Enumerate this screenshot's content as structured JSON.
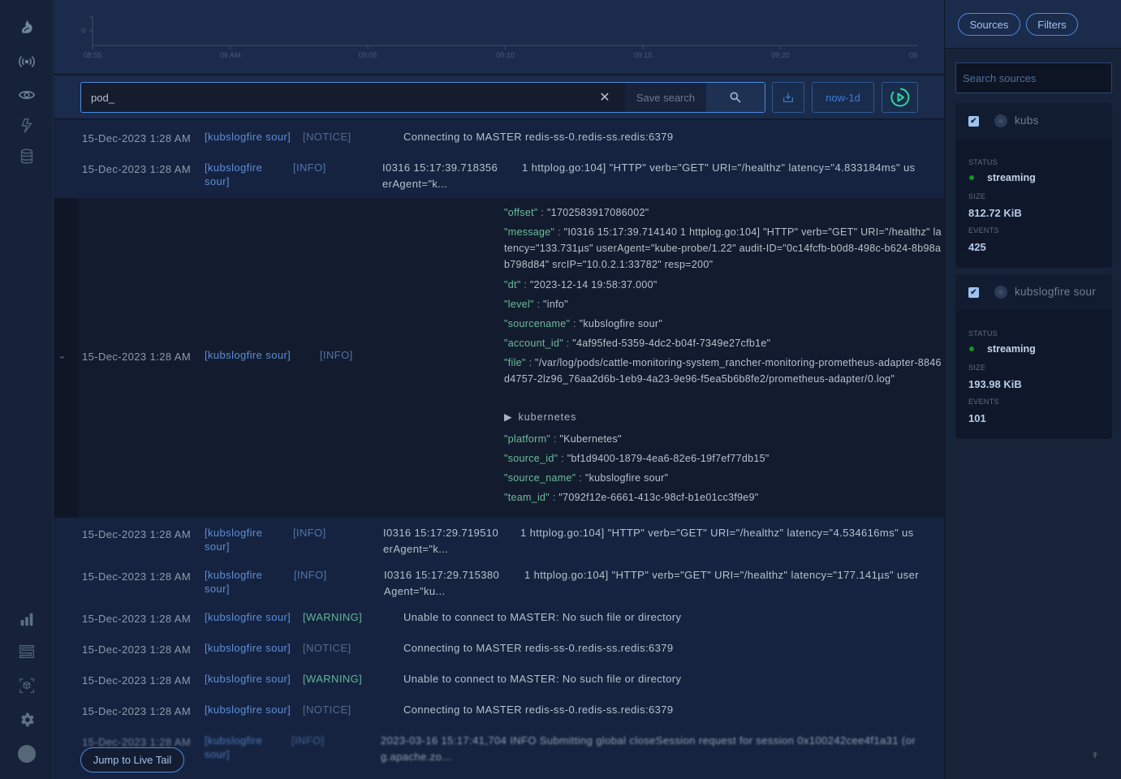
{
  "nav": {
    "icons": [
      "logo-icon",
      "live-broadcast-icon",
      "eye-icon",
      "lightning-icon",
      "database-icon",
      "bar-chart-icon",
      "logo-s-icon",
      "cube-scan-icon",
      "gear-icon",
      "avatar"
    ]
  },
  "chart": {
    "y_tick": "0",
    "x_ticks": [
      "08:55",
      "09 AM",
      "09:05",
      "09:10",
      "09:15",
      "09:20",
      "09"
    ]
  },
  "search": {
    "value": "pod_",
    "clear_label": "✕",
    "save_label": "Save search",
    "time_range": "now-1d"
  },
  "logs": {
    "rows": [
      {
        "ts": "15-Dec-2023 1:28 AM",
        "src": "[kubslogfire sour]",
        "level": "[NOTICE]",
        "msg": "Connecting to MASTER redis-ss-0.redis-ss.redis:6379"
      },
      {
        "ts": "15-Dec-2023 1:28 AM",
        "src_l1": "[kubslogfire",
        "src_l2": "sour]",
        "level": "[INFO]",
        "msg_head": "I0316 15:17:39.718356",
        "msg_tail": "1 httplog.go:104] \"HTTP\" verb=\"GET\" URI=\"/healthz\" latency=\"4.833184ms\" us",
        "msg_l2": "erAgent=\"k..."
      },
      {
        "ts": "15-Dec-2023 1:28 AM",
        "src": "[kubslogfire sour]",
        "level": "[INFO]"
      },
      {
        "ts": "15-Dec-2023 1:28 AM",
        "src_l1": "[kubslogfire",
        "src_l2": "sour]",
        "level": "[INFO]",
        "msg_head": "I0316 15:17:29.719510",
        "msg_tail": "1 httplog.go:104] \"HTTP\" verb=\"GET\" URI=\"/healthz\" latency=\"4.534616ms\" us",
        "msg_l2": "erAgent=\"k..."
      },
      {
        "ts": "15-Dec-2023 1:28 AM",
        "src_l1": "[kubslogfire",
        "src_l2": "sour]",
        "level": "[INFO]",
        "msg_head": "I0316 15:17:29.715380",
        "msg_tail": "1 httplog.go:104] \"HTTP\" verb=\"GET\" URI=\"/healthz\" latency=\"177.141µs\" user",
        "msg_l2": "Agent=\"ku..."
      },
      {
        "ts": "15-Dec-2023 1:28 AM",
        "src": "[kubslogfire sour]",
        "level": "[WARNING]",
        "msg": "Unable to connect to MASTER: No such file or directory"
      },
      {
        "ts": "15-Dec-2023 1:28 AM",
        "src": "[kubslogfire sour]",
        "level": "[NOTICE]",
        "msg": "Connecting to MASTER redis-ss-0.redis-ss.redis:6379"
      },
      {
        "ts": "15-Dec-2023 1:28 AM",
        "src": "[kubslogfire sour]",
        "level": "[WARNING]",
        "msg": "Unable to connect to MASTER: No such file or directory"
      },
      {
        "ts": "15-Dec-2023 1:28 AM",
        "src": "[kubslogfire sour]",
        "level": "[NOTICE]",
        "msg": "Connecting to MASTER redis-ss-0.redis-ss.redis:6379"
      },
      {
        "ts": "15-Dec-2023 1:28 AM",
        "src_l1": "[kubslogfire",
        "src_l2": "sour]",
        "level": "[INFO]",
        "msg_l1": "2023-03-16 15:17:41,704 INFO Submitting global closeSession request for session 0x100242cee4f1a31 (or",
        "msg_l2": "g.apache.zo..."
      }
    ],
    "expanded": {
      "fields": [
        {
          "key": "\"offset\"",
          "value": "\"1702583917086002\""
        },
        {
          "key": "\"message\"",
          "value": "\"I0316 15:17:39.714140 1 httplog.go:104] \"HTTP\" verb=\"GET\" URI=\"/healthz\" latency=\"133.731µs\" userAgent=\"kube-probe/1.22\" audit-ID=\"0c14fcfb-b0d8-498c-b624-8b98ab798d84\" srcIP=\"10.0.2.1:33782\" resp=200\""
        },
        {
          "key": "\"dt\"",
          "value": "\"2023-12-14 19:58:37.000\""
        },
        {
          "key": "\"level\"",
          "value": "\"info\""
        },
        {
          "key": "\"sourcename\"",
          "value": "\"kubslogfire sour\""
        },
        {
          "key": "\"account_id\"",
          "value": "\"4af95fed-5359-4dc2-b04f-7349e27cfb1e\""
        },
        {
          "key": "\"file\"",
          "value": "\"/var/log/pods/cattle-monitoring-system_rancher-monitoring-prometheus-adapter-8846d4757-2lz96_76aa2d6b-1eb9-4a23-9e96-f5ea5b6b8fe2/prometheus-adapter/0.log\""
        },
        {
          "key": "\"platform\"",
          "value": "\"Kubernetes\""
        },
        {
          "key": "\"source_id\"",
          "value": "\"bf1d9400-1879-4ea6-82e6-19f7ef77db15\""
        },
        {
          "key": "\"source_name\"",
          "value": "\"kubslogfire sour\""
        },
        {
          "key": "\"team_id\"",
          "value": "\"7092f12e-6661-413c-98cf-b1e01cc3f9e9\""
        }
      ],
      "kubernetes_label": "kubernetes",
      "separator": ":"
    },
    "jump_live_tail": "Jump to Live Tail"
  },
  "right_panel": {
    "tabs": [
      "Sources",
      "Filters"
    ],
    "search_placeholder": "Search sources",
    "sources": [
      {
        "name": "kubs",
        "checked": true,
        "status_label": "STATUS",
        "status": "streaming",
        "size_label": "SIZE",
        "size": "812.72 KiB",
        "events_label": "EVENTS",
        "events": "425"
      },
      {
        "name": "kubslogfire sour",
        "checked": true,
        "status_label": "STATUS",
        "status": "streaming",
        "size_label": "SIZE",
        "size": "193.98 KiB",
        "events_label": "EVENTS",
        "events": "101"
      }
    ]
  },
  "colors": {
    "accent": "#4d8be0",
    "streaming": "#179125",
    "play": "#2fd3a0",
    "key": "#6cbb9c"
  }
}
